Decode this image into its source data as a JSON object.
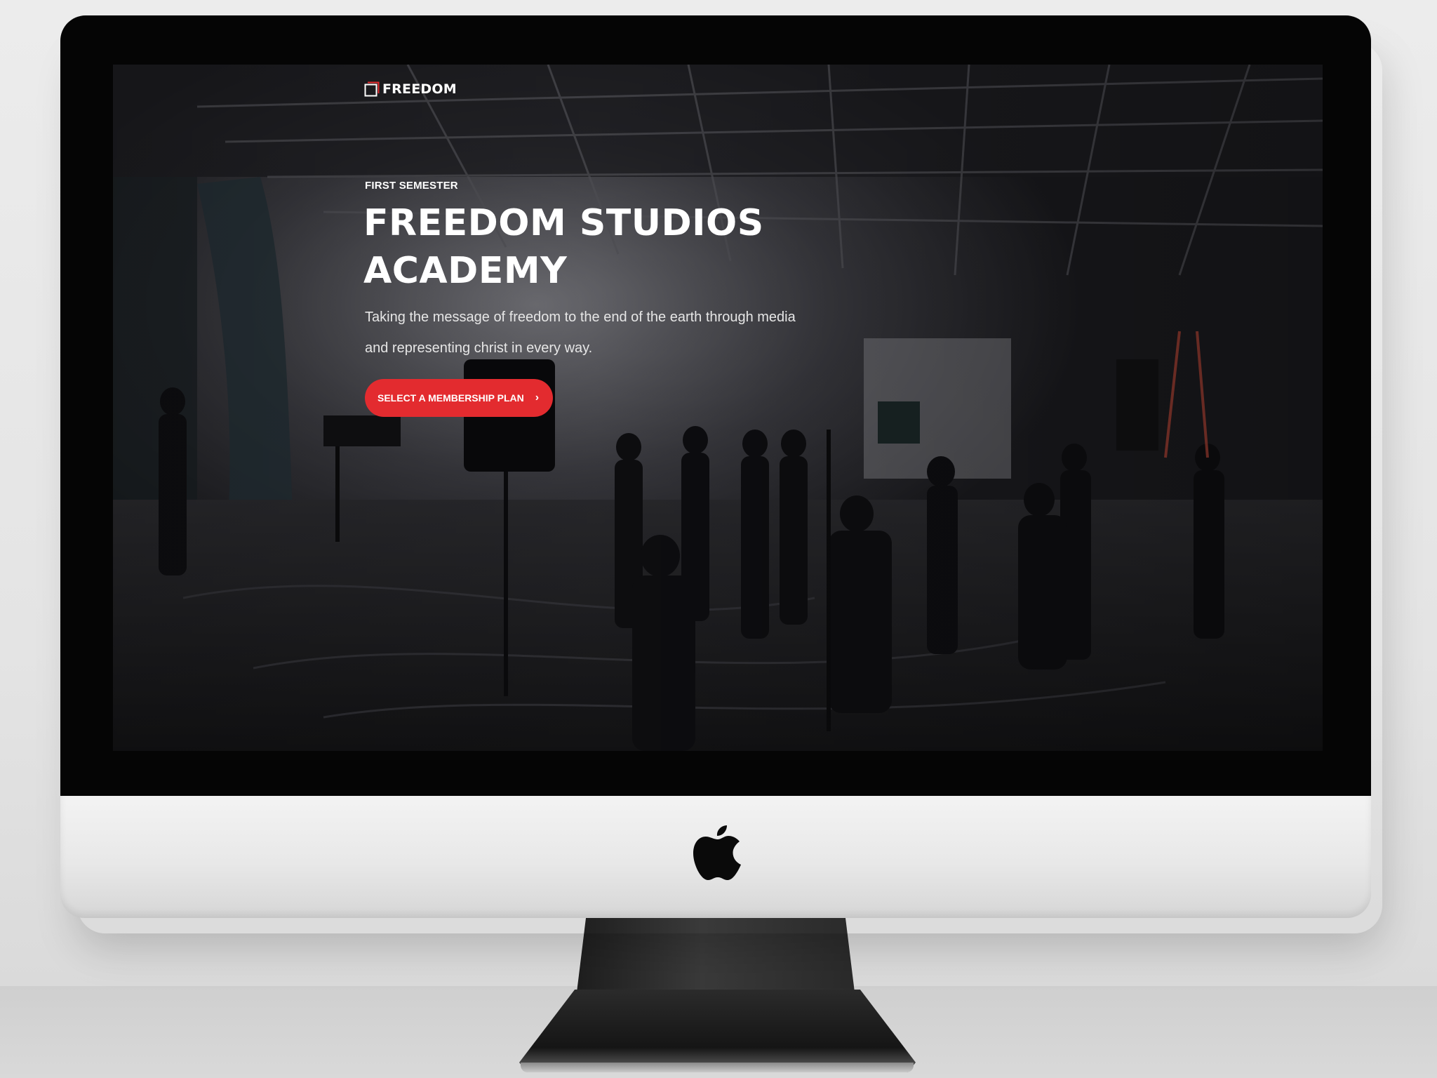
{
  "site": {
    "brand_name": "FREEDOM",
    "brand_icon": "square-bracket-logo-icon"
  },
  "hero": {
    "eyebrow": "FIRST SEMESTER",
    "title_line1": "FREEDOM STUDIOS",
    "title_line2": "ACADEMY",
    "lead_line1": "Taking the message of freedom to the end of the earth through media",
    "lead_line2": "and representing christ in every way.",
    "cta_label": "SELECT A MEMBERSHIP PLAN",
    "cta_icon": "chevron-right-icon",
    "background": "film-studio-photo"
  },
  "device": {
    "type": "imac",
    "logo": "apple-logo-icon"
  },
  "colors": {
    "accent": "#e32b2f",
    "text": "#ffffff",
    "bezel": "#050505",
    "chin": "#ececec"
  }
}
